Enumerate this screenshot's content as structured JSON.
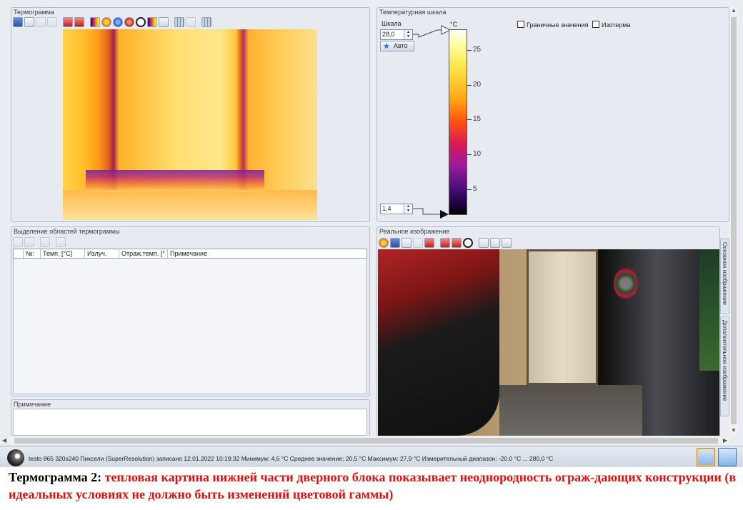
{
  "panels": {
    "thermogram": {
      "title": "Термограмма"
    },
    "scale": {
      "title": "Температурная шкала",
      "scale_label": "Шкала",
      "unit": "°C",
      "max_value": "28,0",
      "min_value": "1,4",
      "auto_label": "Авто",
      "tick_labels": [
        "25",
        "20",
        "15",
        "10",
        "5"
      ],
      "checkbox_limits": "Граничные значения",
      "checkbox_isotherm": "Изотерма"
    },
    "regions": {
      "title": "Выделение областей термограммы",
      "columns": [
        "№:",
        "Темп. [°C]",
        "Излуч.",
        "Отраж.темп. [°",
        "Примечание"
      ]
    },
    "note": {
      "title": "Примечание"
    },
    "real_image": {
      "title": "Реальное изображение",
      "tab_main": "Основное изображение",
      "tab_extra": "Дополнительное изображение"
    }
  },
  "status": {
    "text": "testo 865 320x240 Пиксели (SuperResolution) записано 12.01.2022 10:19:32 Минимум: 4,6 °C Среднее значение: 20,5 °C Максимум: 27,9 °C Измерительный диапазон: -20,0 °C ... 280,0 °C"
  },
  "caption": {
    "label": "Термограмма  2",
    "colon": ": ",
    "text": "тепловая картина нижней части дверного блока показывает неоднородность ограж-дающих конструкции (в идеальных условиях не должно быть изменений цветовой гаммы)"
  },
  "icons": [
    "save-icon",
    "copy-icon",
    "edit-icon",
    "window-icon",
    "palette-icon",
    "ball-icon",
    "no-icon",
    "grid-icon",
    "zoom-in-icon",
    "zoom-out-icon",
    "zoom-fit-icon",
    "delete-icon",
    "contrast-icon"
  ]
}
